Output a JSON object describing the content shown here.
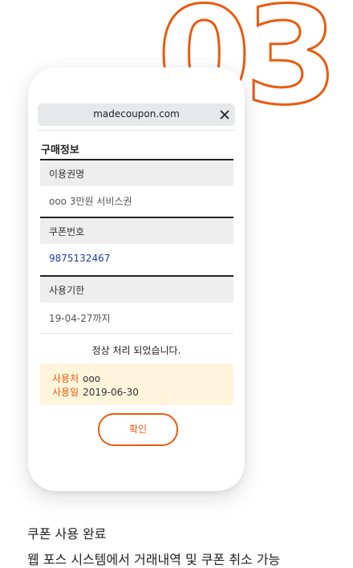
{
  "step_number": "03",
  "browser": {
    "url": "madecoupon.com"
  },
  "purchase_info": {
    "title": "구매정보",
    "fields": [
      {
        "label": "이용권명",
        "value": "ooo 3만원 서비스권"
      },
      {
        "label": "쿠폰번호",
        "value": "9875132467"
      },
      {
        "label": "사용기한",
        "value": "19-04-27까지"
      }
    ]
  },
  "status_message": "정상 처리 되었습니다.",
  "usage": {
    "place_label": "사용처",
    "place_value": "ooo",
    "date_label": "사용일",
    "date_value": "2019-06-30"
  },
  "confirm_label": "확인",
  "caption": {
    "line1": "쿠폰 사용 완료",
    "line2": "웹 포스 시스템에서 거래내역 및 쿠폰 취소 가능"
  },
  "colors": {
    "accent": "#ea5a0f",
    "link": "#1a3fa0",
    "info_bg": "#fff5dd"
  }
}
